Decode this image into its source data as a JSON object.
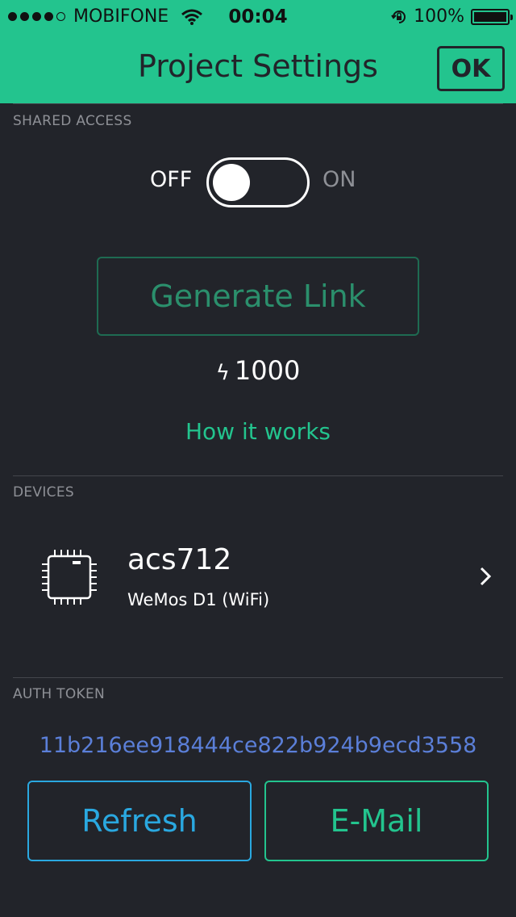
{
  "status_bar": {
    "carrier": "MOBIFONE",
    "time": "00:04",
    "battery_percent": "100%",
    "signal_bars_filled": 4,
    "signal_bars_total": 5
  },
  "nav": {
    "title": "Project Settings",
    "ok_label": "OK"
  },
  "shared_access": {
    "header": "SHARED ACCESS",
    "toggle_off_label": "OFF",
    "toggle_on_label": "ON",
    "toggle_state": "off",
    "generate_link_label": "Generate Link",
    "energy_icon": "bolt-icon",
    "energy_value": "1000",
    "how_it_works_label": "How it works"
  },
  "devices": {
    "header": "DEVICES",
    "items": [
      {
        "name": "acs712",
        "type": "WeMos D1 (WiFi)",
        "icon": "chip-icon"
      }
    ]
  },
  "auth_token": {
    "header": "AUTH TOKEN",
    "value": "11b216ee918444ce822b924b9ecd3558",
    "refresh_label": "Refresh",
    "email_label": "E-Mail"
  },
  "colors": {
    "accent_green": "#23c48e",
    "background": "#22242a",
    "token_blue": "#5b7fd8",
    "refresh_blue": "#2aa8e0"
  }
}
